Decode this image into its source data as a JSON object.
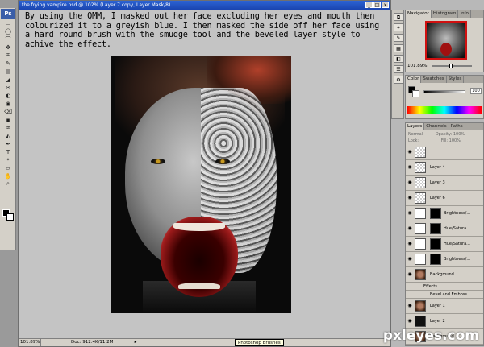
{
  "document": {
    "title": "the frying vampire.psd @ 102% (Layer 7 copy, Layer Mask/8)",
    "controls": [
      "_",
      "□",
      "x"
    ]
  },
  "caption": "By using the QMM, I masked out her face excluding her eyes and mouth then colourized it to a greyish blue.  I then masked the side off her face using a hard round brush with the smudge tool and the beveled layer style to achive the effect.",
  "statusbar": {
    "zoom": "101.89%",
    "docsize": "Doc: 912.4K/11.2M",
    "arrow": "▸",
    "hint": "Photoshop Brushes"
  },
  "toolbox": {
    "logo": "Ps",
    "tools": [
      "▭",
      "◯",
      "⌒",
      "✥",
      "⌗",
      "✎",
      "▤",
      "◢",
      "✂",
      "◐",
      "◉",
      "⌫",
      "▣",
      "♒",
      "◭",
      "✒",
      "T",
      "⌖",
      "▱",
      "✋",
      "⌕"
    ]
  },
  "navigator": {
    "tabs": [
      "Navigator",
      "Histogram",
      "Info"
    ],
    "zoom": "101.89%"
  },
  "color": {
    "tabs": [
      "Color",
      "Swatches",
      "Styles"
    ],
    "k_value": "100"
  },
  "layers": {
    "tabs": [
      "Layers",
      "Channels",
      "Paths"
    ],
    "blend": "Normal",
    "opacity_label": "Opacity: 100%",
    "lock_label": "Lock:",
    "fill_label": "Fill: 100%",
    "rows": [
      {
        "name": "",
        "kind": "layer"
      },
      {
        "name": "Layer 4",
        "kind": "layer"
      },
      {
        "name": "Layer 3",
        "kind": "layer"
      },
      {
        "name": "Layer 6",
        "kind": "layer"
      },
      {
        "name": "Brightness/...",
        "kind": "adj"
      },
      {
        "name": "Hue/Satura...",
        "kind": "adj"
      },
      {
        "name": "Hue/Satura...",
        "kind": "adj"
      },
      {
        "name": "Brightness/...",
        "kind": "adj"
      },
      {
        "name": "Background...",
        "kind": "photo"
      },
      {
        "name": "Effects",
        "kind": "sub"
      },
      {
        "name": "Bevel and Emboss",
        "kind": "sub2"
      },
      {
        "name": "Layer 1",
        "kind": "photo"
      },
      {
        "name": "Layer 2",
        "kind": "dark"
      },
      {
        "name": "Background",
        "kind": "photo"
      }
    ]
  },
  "panel_icons": [
    "⧉",
    "⌗",
    "✎",
    "▦",
    "◧",
    "☰",
    "⚙"
  ],
  "watermark": "pxleyes.com"
}
